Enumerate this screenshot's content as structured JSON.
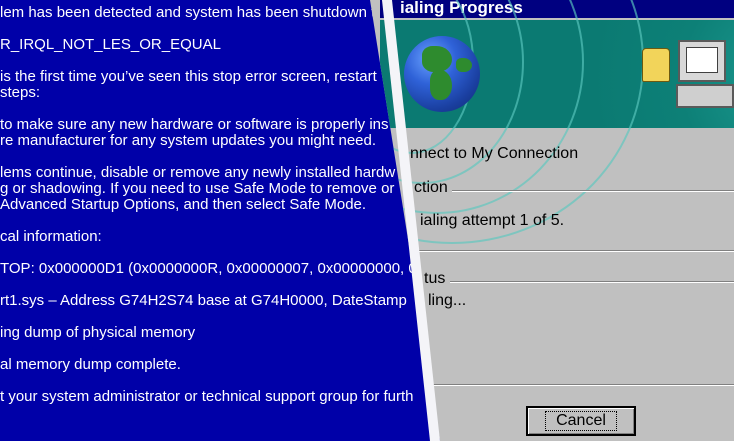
{
  "bsod": {
    "lines": [
      "lem has been detected and system has been shutdown t",
      "R_IRQL_NOT_LES_OR_EQUAL",
      "is the first time you’ve seen this stop error screen, restart",
      "steps:",
      "to make sure any new hardware or software is properly ins",
      "re manufacturer for any system updates you might need.",
      "lems continue, disable or remove any newly installed hardw",
      "g or shadowing. If you need to use Safe Mode to remove or",
      "Advanced Startup Options, and then select Safe Mode.",
      "cal information:",
      "TOP: 0x000000D1 (0x0000000R, 0x00000007, 0x00000000, 0",
      "rt1.sys – Address G74H2S74 base at G74H0000, DateStamp",
      "ing dump of physical memory",
      "al memory dump complete.",
      "t your system administrator or technical support group for furth"
    ]
  },
  "dialog": {
    "title": "ialing Progress",
    "connect_line": "nnect to My Connection",
    "connection_group_label": "ction",
    "attempt_text": "ialing attempt 1 of 5.",
    "status_group_label": "tus",
    "status_text": "ling...",
    "cancel_label": "Cancel"
  },
  "colors": {
    "bsod_background": "#0000a8",
    "dialog_background": "#c0c0c0",
    "banner_teal": "#0d8077"
  }
}
